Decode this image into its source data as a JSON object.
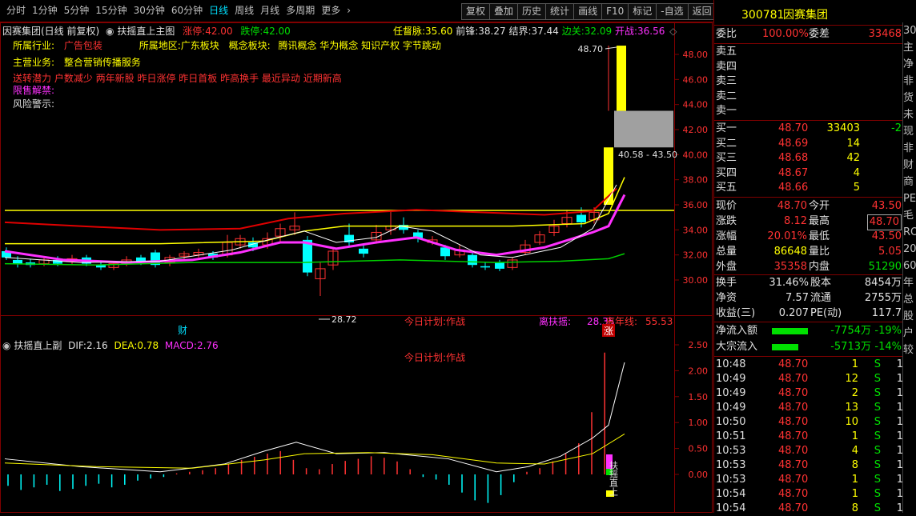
{
  "toolbar": {
    "periods": [
      "分时",
      "1分钟",
      "5分钟",
      "15分钟",
      "30分钟",
      "60分钟",
      "日线",
      "周线",
      "月线",
      "多周期",
      "更多"
    ],
    "active_period": "日线",
    "buttons": [
      "复权",
      "叠加",
      "历史",
      "统计",
      "画线",
      "F10",
      "标记",
      "-自选",
      "返回"
    ]
  },
  "main_header": {
    "stock": "因赛集团(日线 前复权)",
    "indicator": "扶摇直上主图",
    "zhangting_label": "涨停:",
    "zhangting_value": "42.00",
    "dieting_label": "跌停:",
    "dieting_value": "42.00",
    "rendumai_label": "任督脉:",
    "rendumai_value": "35.60",
    "qianfeng_label": "前锋:",
    "qianfeng_value": "38.27",
    "jiejie_label": "结界:",
    "jiejie_value": "37.44",
    "bianguan_label": "边关:",
    "bianguan_value": "32.09",
    "kaizhan_label": "开战:",
    "kaizhan_value": "36.56"
  },
  "info": {
    "industry_label": "所属行业:",
    "industry_value": "广告包装",
    "region_label": "所属地区:",
    "region_value": "广东板块",
    "concept_label": "概念板块:",
    "concept_value": "腾讯概念 华为概念 知识产权 字节跳动",
    "business_label": "主营业务:",
    "business_value": "整合营销传播服务",
    "tags": "送转潜力 户数减少 两年新股 昨日涨停 昨日首板 昨高换手 最近异动 近期新高",
    "unlock_label": "限售解禁:",
    "risk_label": "风险警示:"
  },
  "main_chart_labels": {
    "high_label": "48.70",
    "low_label": "28.72",
    "range_label": "40.58 - 43.50",
    "plan_text": "今日计划:作战",
    "lifuyao_label": "离扶摇:",
    "lifuyao_value": "28.35",
    "linianxian_label": "离年线:",
    "linianxian_value": "55.53",
    "cai_marker": "财",
    "zhang_marker": "涨",
    "y_ticks": [
      "48.00",
      "46.00",
      "44.00",
      "42.00",
      "40.00",
      "38.00",
      "36.00",
      "34.00",
      "32.00",
      "30.00"
    ]
  },
  "sub_header": {
    "indicator": "扶摇直上副",
    "dif_label": "DIF:",
    "dif_value": "2.16",
    "dea_label": "DEA:",
    "dea_value": "0.78",
    "macd_label": "MACD:",
    "macd_value": "2.76",
    "plan_text": "今日计划:作战",
    "vertical_text": "扶摇直上",
    "y_ticks": [
      "2.50",
      "2.00",
      "1.50",
      "1.00",
      "0.50",
      "0.00"
    ]
  },
  "quote": {
    "code": "300781",
    "name": "因赛集团",
    "weibi_label": "委比",
    "weibi_value": "100.00%",
    "weicha_label": "委差",
    "weicha_value": "33468",
    "sell": [
      {
        "label": "卖五",
        "price": "",
        "vol": ""
      },
      {
        "label": "卖四",
        "price": "",
        "vol": ""
      },
      {
        "label": "卖三",
        "price": "",
        "vol": ""
      },
      {
        "label": "卖二",
        "price": "",
        "vol": ""
      },
      {
        "label": "卖一",
        "price": "",
        "vol": ""
      }
    ],
    "buy": [
      {
        "label": "买一",
        "price": "48.70",
        "vol": "33403",
        "chg": "-2"
      },
      {
        "label": "买二",
        "price": "48.69",
        "vol": "14",
        "chg": ""
      },
      {
        "label": "买三",
        "price": "48.68",
        "vol": "42",
        "chg": ""
      },
      {
        "label": "买四",
        "price": "48.67",
        "vol": "4",
        "chg": ""
      },
      {
        "label": "买五",
        "price": "48.66",
        "vol": "5",
        "chg": ""
      }
    ],
    "stats": [
      {
        "l1": "现价",
        "v1": "48.70",
        "l2": "今开",
        "v2": "43.50",
        "c1": "red",
        "c2": "red"
      },
      {
        "l1": "涨跌",
        "v1": "8.12",
        "l2": "最高",
        "v2": "48.70",
        "c1": "red",
        "c2": "red"
      },
      {
        "l1": "涨幅",
        "v1": "20.01%",
        "l2": "最低",
        "v2": "43.50",
        "c1": "red",
        "c2": "red"
      },
      {
        "l1": "总量",
        "v1": "86648",
        "l2": "量比",
        "v2": "5.05",
        "c1": "yellow",
        "c2": "red"
      },
      {
        "l1": "外盘",
        "v1": "35358",
        "l2": "内盘",
        "v2": "51290",
        "c1": "red",
        "c2": "green"
      }
    ],
    "stats2": [
      {
        "l1": "换手",
        "v1": "31.46%",
        "l2": "股本",
        "v2": "8454万"
      },
      {
        "l1": "净资",
        "v1": "7.57",
        "l2": "流通",
        "v2": "2755万"
      },
      {
        "l1": "收益(三)",
        "v1": "0.207",
        "l2": "PE(动)",
        "v2": "117.7"
      }
    ],
    "flow": [
      {
        "label": "净流入额",
        "value": "-7754万",
        "pct": "-19%",
        "bar": 0.75
      },
      {
        "label": "大宗流入",
        "value": "-5713万",
        "pct": "-14%",
        "bar": 0.55
      }
    ],
    "ticks": [
      {
        "time": "10:48",
        "price": "48.70",
        "vol": "1",
        "side": "S",
        "n": "1"
      },
      {
        "time": "10:49",
        "price": "48.70",
        "vol": "12",
        "side": "S",
        "n": "1"
      },
      {
        "time": "10:49",
        "price": "48.70",
        "vol": "2",
        "side": "S",
        "n": "1"
      },
      {
        "time": "10:49",
        "price": "48.70",
        "vol": "13",
        "side": "S",
        "n": "1"
      },
      {
        "time": "10:50",
        "price": "48.70",
        "vol": "10",
        "side": "S",
        "n": "1"
      },
      {
        "time": "10:51",
        "price": "48.70",
        "vol": "1",
        "side": "S",
        "n": "1"
      },
      {
        "time": "10:53",
        "price": "48.70",
        "vol": "4",
        "side": "S",
        "n": "1"
      },
      {
        "time": "10:53",
        "price": "48.70",
        "vol": "8",
        "side": "S",
        "n": "1"
      },
      {
        "time": "10:53",
        "price": "48.70",
        "vol": "1",
        "side": "S",
        "n": "1"
      },
      {
        "time": "10:54",
        "price": "48.70",
        "vol": "1",
        "side": "S",
        "n": "1"
      },
      {
        "time": "10:54",
        "price": "48.70",
        "vol": "8",
        "side": "S",
        "n": "1"
      }
    ]
  },
  "strip": [
    "30",
    "",
    "",
    "主",
    "净",
    "非",
    "货",
    "未",
    "现",
    "非",
    "财",
    "商",
    "",
    "PE",
    "毛",
    "RO",
    "",
    "20",
    "60",
    "年",
    "总",
    "",
    "股",
    "户",
    "较"
  ],
  "colors": {
    "up": "#ff3232",
    "down": "#00ffff",
    "ma_red": "#e00000",
    "ma_yellow": "#ffff00",
    "ma_magenta": "#ff30ff",
    "ma_green": "#00d000",
    "frame": "#800000"
  }
}
